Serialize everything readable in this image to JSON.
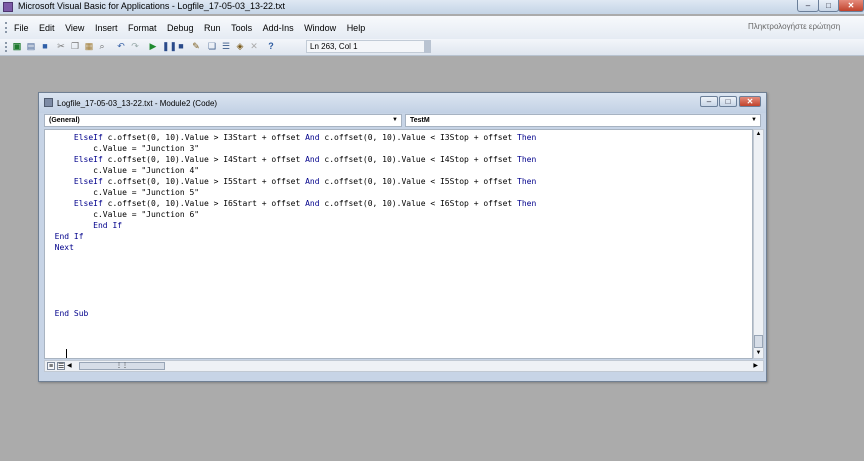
{
  "app": {
    "title": "Microsoft Visual Basic for Applications - Logfile_17-05-03_13-22.txt",
    "min_label": "–",
    "max_label": "□",
    "close_label": "✕"
  },
  "menu": {
    "items": [
      "File",
      "Edit",
      "View",
      "Insert",
      "Format",
      "Debug",
      "Run",
      "Tools",
      "Add-Ins",
      "Window",
      "Help"
    ],
    "help_placeholder": "Πληκτρολογήστε ερώτηση"
  },
  "toolbar": {
    "status": "Ln 263, Col 1"
  },
  "code_window": {
    "title": "Logfile_17-05-03_13-22.txt - Module2 (Code)",
    "object_combo": "(General)",
    "procedure_combo": "TestM",
    "lines": [
      "      ElseIf c.offset(0, 10).Value > I3Start + offset And c.offset(0, 10).Value < I3Stop + offset Then",
      "          c.Value = \"Junction 3\"",
      "      ElseIf c.offset(0, 10).Value > I4Start + offset And c.offset(0, 10).Value < I4Stop + offset Then",
      "          c.Value = \"Junction 4\"",
      "      ElseIf c.offset(0, 10).Value > I5Start + offset And c.offset(0, 10).Value < I5Stop + offset Then",
      "          c.Value = \"Junction 5\"",
      "      ElseIf c.offset(0, 10).Value > I6Start + offset And c.offset(0, 10).Value < I6Stop + offset Then",
      "          c.Value = \"Junction 6\"",
      "          End If",
      "  End If",
      "  Next",
      "",
      "",
      "",
      "",
      "",
      "  End Sub"
    ]
  },
  "colors": {
    "keyword": "#00008b",
    "text": "#000000",
    "workspace": "#ababab"
  }
}
